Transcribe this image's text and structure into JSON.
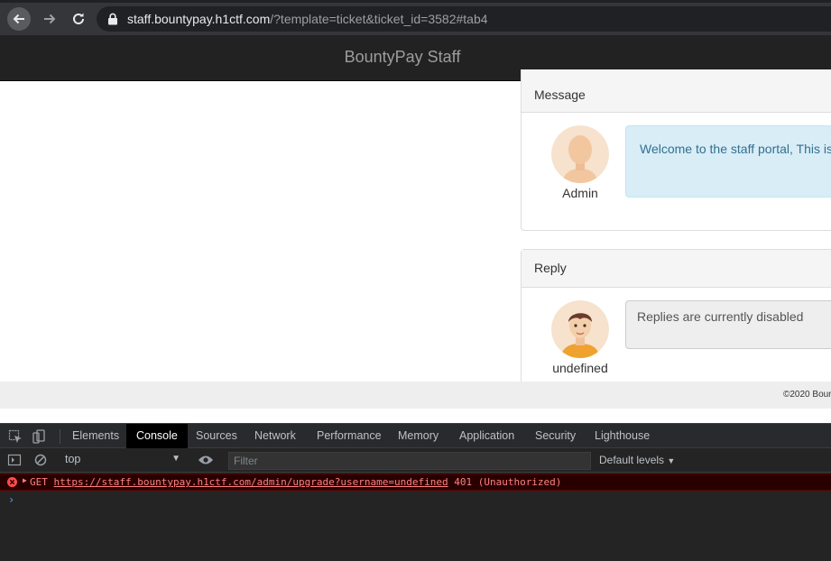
{
  "browser": {
    "url_host": "staff.bountypay.h1ctf.com",
    "url_path": "/?template=ticket&ticket_id=3582#tab4"
  },
  "page": {
    "brand": "BountyPay Staff",
    "message_panel": {
      "heading": "Message",
      "author": "Admin",
      "text": "Welcome to the staff portal, This is"
    },
    "reply_panel": {
      "heading": "Reply",
      "author": "undefined",
      "text": "Replies are currently disabled"
    },
    "footer": "©2020 Boun"
  },
  "devtools": {
    "tabs": [
      "Elements",
      "Console",
      "Sources",
      "Network",
      "Performance",
      "Memory",
      "Application",
      "Security",
      "Lighthouse"
    ],
    "active_tab": "Console",
    "context": "top",
    "filter_placeholder": "Filter",
    "levels": "Default levels",
    "error": {
      "method": "GET",
      "url": "https://staff.bountypay.h1ctf.com/admin/upgrade?username=undefined",
      "status": "401 (Unauthorized)"
    },
    "prompt": "›"
  },
  "colors": {
    "navbar": "#222222",
    "info_bg": "#d9edf7",
    "error_bg": "#290000",
    "error_text": "#ff8080"
  }
}
